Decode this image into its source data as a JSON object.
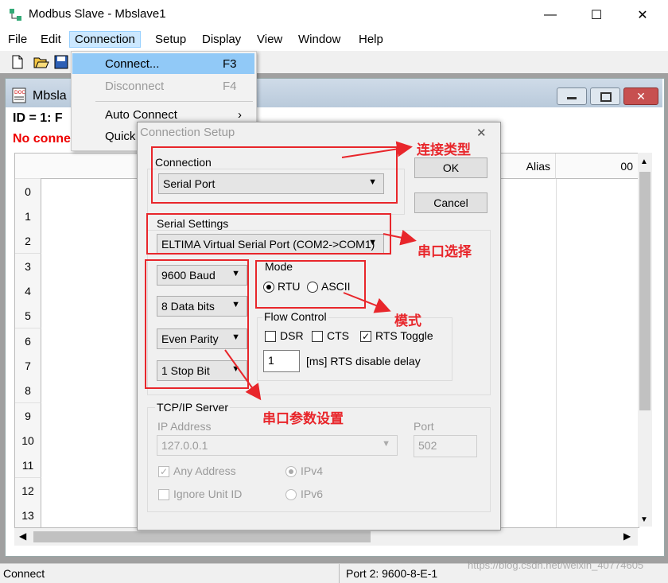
{
  "app": {
    "title": "Modbus Slave - Mbslave1",
    "minimize": "—",
    "maximize": "☐",
    "close": "✕"
  },
  "menu": {
    "file": "File",
    "edit": "Edit",
    "connection": "Connection",
    "setup": "Setup",
    "display": "Display",
    "view": "View",
    "window": "Window",
    "help": "Help"
  },
  "dropdown": {
    "connect": "Connect...",
    "connect_sc": "F3",
    "disconnect": "Disconnect",
    "disconnect_sc": "F4",
    "auto_connect": "Auto Connect",
    "auto_connect_arrow": "›",
    "quick": "Quick"
  },
  "child": {
    "title": "Mbsla",
    "id_line": "ID = 1: F",
    "status_line": "No conne",
    "columns": [
      "Alias",
      "Alias",
      "00"
    ],
    "rows": [
      "0",
      "1",
      "2",
      "3",
      "4",
      "5",
      "6",
      "7",
      "8",
      "9",
      "10",
      "11",
      "12",
      "13"
    ]
  },
  "dialog": {
    "title": "Connection Setup",
    "close": "✕",
    "ok": "OK",
    "cancel": "Cancel",
    "connection_label": "Connection",
    "connection_value": "Serial Port",
    "serial_settings_label": "Serial Settings",
    "serial_port_value": "ELTIMA Virtual Serial Port (COM2->COM1)",
    "baud": "9600 Baud",
    "data_bits": "8 Data bits",
    "parity": "Even Parity",
    "stop_bit": "1 Stop Bit",
    "mode_label": "Mode",
    "rtu": "RTU",
    "ascii": "ASCII",
    "flow_label": "Flow Control",
    "dsr": "DSR",
    "cts": "CTS",
    "rts_toggle": "RTS Toggle",
    "rts_delay_value": "1",
    "rts_delay_label": "[ms] RTS disable delay",
    "tcp_label": "TCP/IP Server",
    "ip_label": "IP Address",
    "ip_value": "127.0.0.1",
    "port_label": "Port",
    "port_value": "502",
    "any_address": "Any Address",
    "ignore_unit": "Ignore Unit ID",
    "ipv4": "IPv4",
    "ipv6": "IPv6"
  },
  "annotations": {
    "conn_type": "连接类型",
    "port_select": "串口选择",
    "mode": "模式",
    "serial_params": "串口参数设置"
  },
  "status": {
    "left": "Connect",
    "port": "Port 2: 9600-8-E-1",
    "watermark": "https://blog.csdn.net/weixin_40774605"
  },
  "colors": {
    "annotation_red": "#e8262b",
    "menu_highlight": "#cce8ff"
  }
}
